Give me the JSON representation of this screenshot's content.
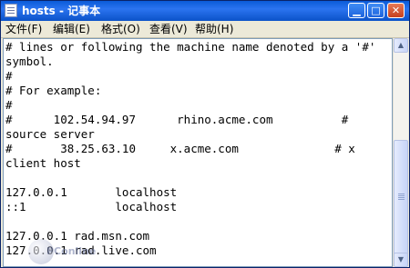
{
  "window": {
    "title": "hosts - 记事本"
  },
  "menu": [
    "文件(F)",
    "编辑(E)",
    "格式(O)",
    "查看(V)",
    "帮助(H)"
  ],
  "content_lines": [
    "# lines or following the machine name denoted by a '#'",
    "symbol.",
    "#",
    "# For example:",
    "#",
    "#      102.54.94.97      rhino.acme.com          #",
    "source server",
    "#       38.25.63.10     x.acme.com              # x",
    "client host",
    "",
    "127.0.0.1       localhost",
    "::1             localhost",
    "",
    "127.0.0.1 rad.msn.com",
    "127.0.0.1 rad.live.com"
  ],
  "watermark": {
    "text": "PConline"
  },
  "icons": {
    "app": "notepad-icon",
    "minimize": "minimize-icon",
    "maximize": "maximize-icon",
    "close": "close-icon"
  }
}
